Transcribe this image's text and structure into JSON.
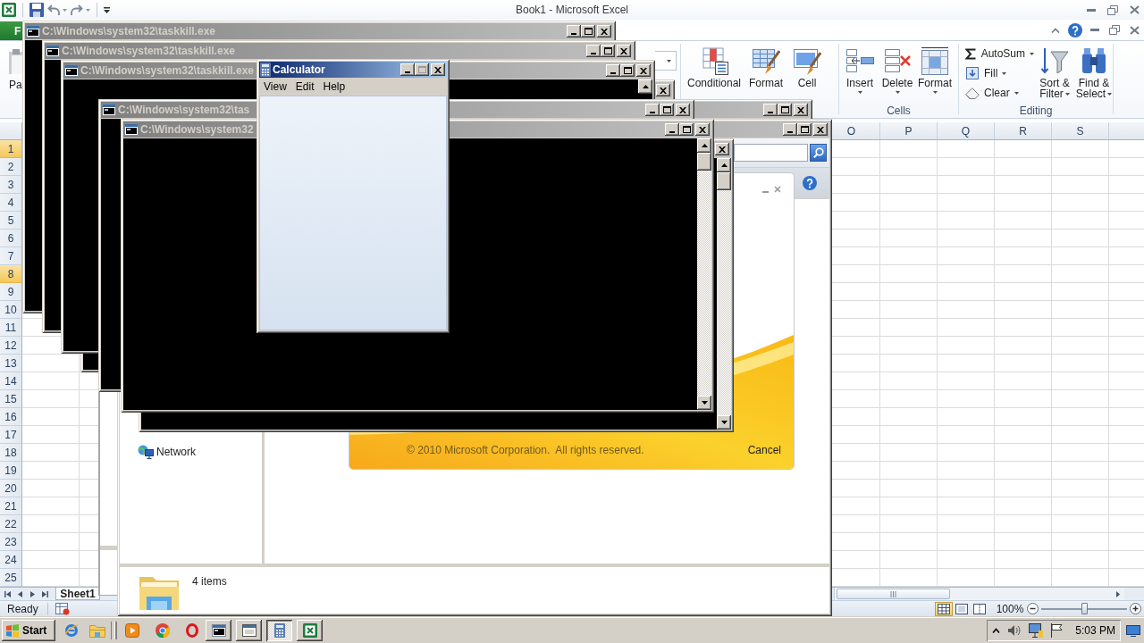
{
  "excel": {
    "title": "Book1 - Microsoft Excel",
    "file_tab": "F",
    "paste_label": "Pa",
    "styles_group": {
      "buttons": [
        {
          "label": "Conditional"
        },
        {
          "label": "Format"
        },
        {
          "label": "Cell"
        }
      ]
    },
    "cells_group": {
      "label": "Cells",
      "buttons": [
        {
          "label": "Insert"
        },
        {
          "label": "Delete"
        },
        {
          "label": "Format"
        }
      ]
    },
    "editing_group": {
      "label": "Editing",
      "small_buttons": [
        {
          "label": "AutoSum"
        },
        {
          "label": "Fill"
        },
        {
          "label": "Clear"
        }
      ],
      "large_buttons": [
        {
          "label": "Sort & Filter"
        },
        {
          "label": "Find & Select"
        }
      ]
    },
    "columns": [
      "O",
      "P",
      "Q",
      "R",
      "S"
    ],
    "rows": [
      {
        "label": "1",
        "selected": true
      },
      {
        "label": "2",
        "selected": false
      },
      {
        "label": "3",
        "selected": false
      },
      {
        "label": "4",
        "selected": false
      },
      {
        "label": "5",
        "selected": false
      },
      {
        "label": "6",
        "selected": false
      },
      {
        "label": "7",
        "selected": false
      },
      {
        "label": "8",
        "selected": true
      },
      {
        "label": "9",
        "selected": false
      },
      {
        "label": "10",
        "selected": false
      },
      {
        "label": "11",
        "selected": false
      },
      {
        "label": "12",
        "selected": false
      },
      {
        "label": "13",
        "selected": false
      },
      {
        "label": "14",
        "selected": false
      },
      {
        "label": "15",
        "selected": false
      },
      {
        "label": "16",
        "selected": false
      },
      {
        "label": "17",
        "selected": false
      },
      {
        "label": "18",
        "selected": false
      },
      {
        "label": "19",
        "selected": false
      },
      {
        "label": "20",
        "selected": false
      },
      {
        "label": "21",
        "selected": false
      },
      {
        "label": "22",
        "selected": false
      },
      {
        "label": "23",
        "selected": false
      },
      {
        "label": "24",
        "selected": false
      },
      {
        "label": "25",
        "selected": false
      }
    ],
    "sheet_tabs": [
      {
        "label": "Sheet1",
        "selected": true
      }
    ],
    "status": "Ready",
    "views": [
      {
        "selected": true
      },
      {
        "selected": false
      },
      {
        "selected": false
      }
    ],
    "zoom": {
      "reading": "100%",
      "level": 0.5
    }
  },
  "console_windows": [
    {
      "title": "C:\\Windows\\system32\\taskkill.exe",
      "active": false
    },
    {
      "title": "C:\\Windows\\system32\\taskkill.exe",
      "active": false
    },
    {
      "title": "C:\\Windows\\system32\\taskkill.exe",
      "active": false
    },
    {
      "active": false
    },
    {
      "title": "C:\\Windows\\system32\\tas",
      "active": false
    },
    {
      "active": false
    },
    {
      "title": "C:\\Windows\\system32",
      "active": false
    },
    {
      "active": false
    }
  ],
  "explorer": {
    "active": false,
    "nav_items": [
      "Network"
    ],
    "status": "4 items"
  },
  "splash": {
    "copyright": "© 2010 Microsoft Corporation.  All rights reserved.",
    "cancel": "Cancel"
  },
  "calculator": {
    "title": "Calculator",
    "active": true,
    "maximize_disabled": true,
    "menu": [
      "View",
      "Edit",
      "Help"
    ]
  },
  "taskbar": {
    "start": "Start",
    "tasks": [
      {
        "selected": false
      },
      {
        "selected": false
      },
      {
        "selected": true
      },
      {
        "selected": false
      }
    ],
    "clock": "5:03 PM"
  }
}
